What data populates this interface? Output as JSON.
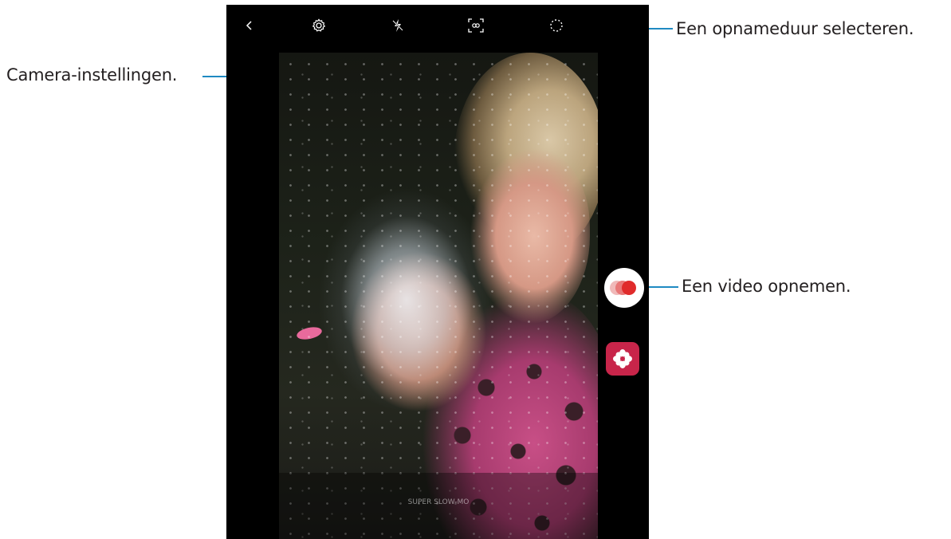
{
  "callouts": {
    "settings": "Camera-instellingen.",
    "duration": "Een opnameduur selecteren.",
    "record": "Een video opnemen."
  },
  "toolbar": {
    "icons": [
      "back-icon",
      "settings-gear-icon",
      "flash-off-icon",
      "auto-detect-icon",
      "duration-icon"
    ]
  },
  "colors": {
    "callout_line": "#1f8ac2",
    "record_red": "#e02b2b",
    "gallery_red": "#c8254a"
  },
  "viewfinder": {
    "mode_text": "SUPER SLOW-MO"
  }
}
